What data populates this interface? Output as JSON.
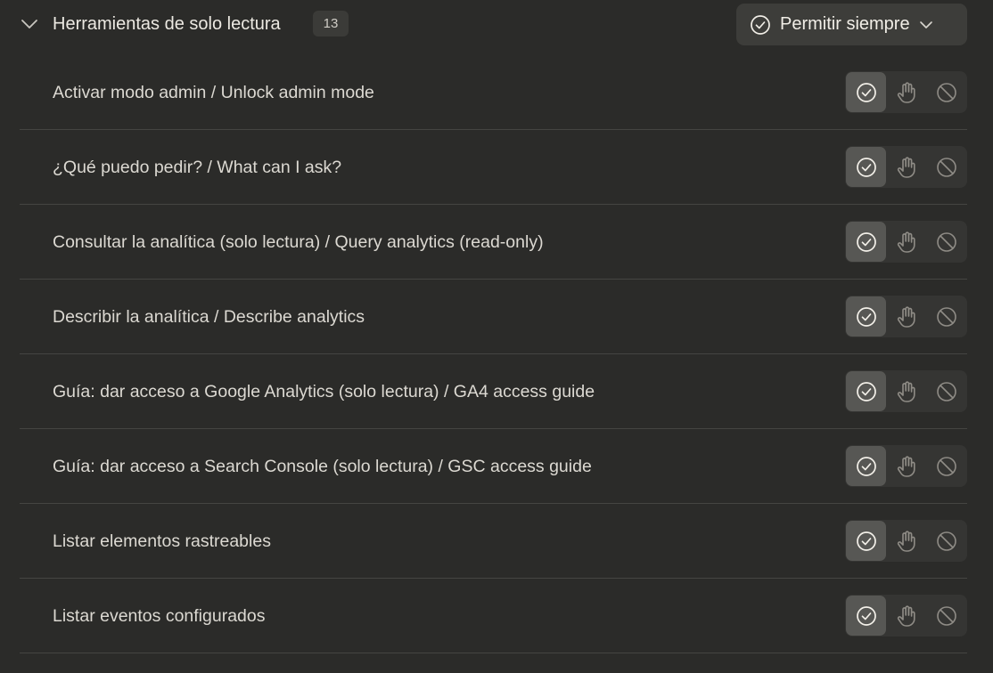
{
  "section": {
    "title": "Herramientas de solo lectura",
    "count": "13",
    "collapse_icon": "chevron-down-icon",
    "permission": {
      "label": "Permitir siempre",
      "icon": "check-circle-icon",
      "dropdown_icon": "chevron-down-icon"
    }
  },
  "tools": [
    {
      "label": "Activar modo admin / Unlock admin mode",
      "state": "allow"
    },
    {
      "label": "¿Qué puedo pedir? / What can I ask?",
      "state": "allow"
    },
    {
      "label": "Consultar la analítica (solo lectura) / Query analytics (read-only)",
      "state": "allow"
    },
    {
      "label": "Describir la analítica / Describe analytics",
      "state": "allow"
    },
    {
      "label": "Guía: dar acceso a Google Analytics (solo lectura) / GA4 access guide",
      "state": "allow"
    },
    {
      "label": "Guía: dar acceso a Search Console (solo lectura) / GSC access guide",
      "state": "allow"
    },
    {
      "label": "Listar elementos rastreables",
      "state": "allow"
    },
    {
      "label": "Listar eventos configurados",
      "state": "allow"
    }
  ],
  "toggle_icons": [
    "check-circle-icon",
    "hand-icon",
    "block-icon"
  ],
  "colors": {
    "background": "#2b2b29",
    "active_toggle": "#575754",
    "toggle_group": "#353533",
    "divider": "#454542"
  }
}
